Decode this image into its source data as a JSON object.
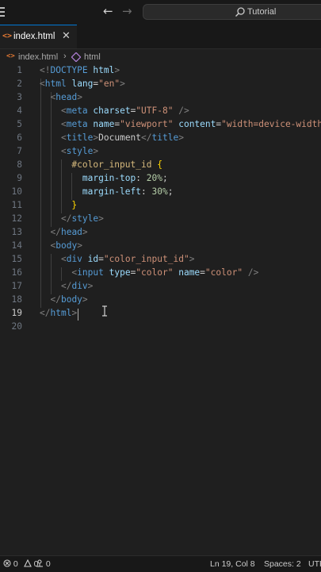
{
  "titlebar": {
    "search_label": "Tutorial"
  },
  "tabs": [
    {
      "icon": "<>",
      "label": "index.html",
      "close": "✕"
    }
  ],
  "breadcrumb": {
    "file_icon": "<>",
    "file": "index.html",
    "separator": "›",
    "element": "html"
  },
  "editor": {
    "active_line": 19,
    "line_numbers": [
      "1",
      "2",
      "3",
      "4",
      "5",
      "6",
      "7",
      "8",
      "9",
      "10",
      "11",
      "12",
      "13",
      "14",
      "15",
      "16",
      "17",
      "18",
      "19",
      "20"
    ]
  },
  "statusbar": {
    "errors": "0",
    "warnings": "0",
    "ports": "0",
    "position": "Ln 19, Col 8",
    "spaces": "Spaces: 2",
    "encoding": "UTF"
  },
  "colors": {
    "background": "#1f1f1f",
    "tag": "#569cd6",
    "attribute": "#9cdcfe",
    "string": "#ce9178",
    "selector": "#d7ba7d",
    "number": "#b5cea8",
    "brace": "#ffd700",
    "html_icon": "#e37933"
  },
  "icons": [
    "menu-icon",
    "arrow-left-icon",
    "arrow-right-icon",
    "search-icon",
    "html-file-icon",
    "close-icon",
    "code-element-icon",
    "error-icon",
    "warning-icon",
    "port-icon",
    "text-cursor-icon"
  ]
}
